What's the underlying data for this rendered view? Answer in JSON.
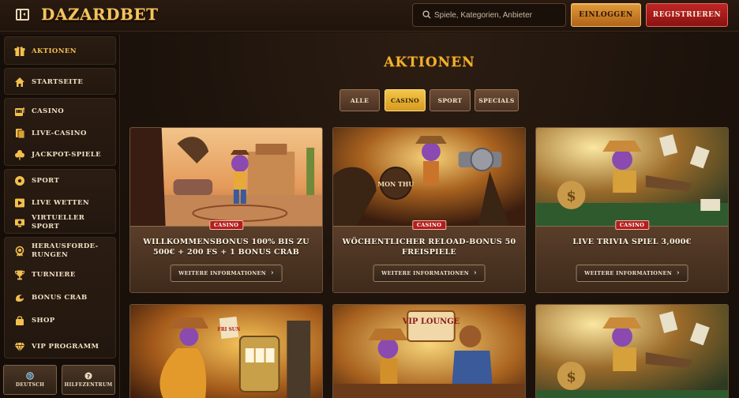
{
  "header": {
    "logo_text": "DAZARDBET",
    "search_placeholder": "Spiele, Kategorien, Anbieter",
    "login_label": "EINLOGGEN",
    "register_label": "REGISTRIEREN"
  },
  "sidebar": {
    "items": [
      {
        "label": "AKTIONEN",
        "icon": "gift-icon"
      },
      {
        "label": "STARTSEITE",
        "icon": "home-icon"
      },
      {
        "label": "CASINO",
        "icon": "slot-machine-icon"
      },
      {
        "label": "LIVE-CASINO",
        "icon": "playing-card-icon"
      },
      {
        "label": "JACKPOT-SPIELE",
        "icon": "clover-icon"
      },
      {
        "label": "SPORT",
        "icon": "soccer-ball-icon"
      },
      {
        "label": "LIVE WETTEN",
        "icon": "play-icon"
      },
      {
        "label": "VIRTUELLER SPORT",
        "icon": "virtual-sport-icon"
      },
      {
        "label": "HERAUSFORDE-RUNGEN",
        "icon": "medal-icon"
      },
      {
        "label": "TURNIERE",
        "icon": "trophy-icon"
      },
      {
        "label": "BONUS CRAB",
        "icon": "crab-icon"
      },
      {
        "label": "SHOP",
        "icon": "shop-bag-icon"
      },
      {
        "label": "VIP PROGRAMM",
        "icon": "diamond-icon"
      }
    ],
    "language_label": "DEUTSCH",
    "help_label": "HILFEZENTRUM"
  },
  "main": {
    "title": "AKTIONEN",
    "filters": [
      "ALLE",
      "CASINO",
      "SPORT",
      "SPECIALS"
    ],
    "active_filter": "CASINO",
    "info_label": "WEITERE INFORMATIONEN",
    "cards": [
      {
        "badge": "CASINO",
        "title": "WILLKOMMENSBONUS 100% BIS ZU 500€ + 200 FS + 1 BONUS CRAB"
      },
      {
        "badge": "CASINO",
        "title": "WÖCHENTLICHER RELOAD-BONUS 50 FREISPIELE"
      },
      {
        "badge": "CASINO",
        "title": "LIVE TRIVIA SPIEL 3,000€"
      }
    ],
    "art_text": {
      "mon_thu": "MON THU",
      "vip_lounge": "VIP LOUNGE",
      "fri_sun": "FRI SUN"
    }
  },
  "colors": {
    "accent_gold": "#f2b12c",
    "login_orange": "#e19a38",
    "register_red": "#c02626",
    "badge_red": "#b51d1d",
    "background": "#1d120b"
  }
}
